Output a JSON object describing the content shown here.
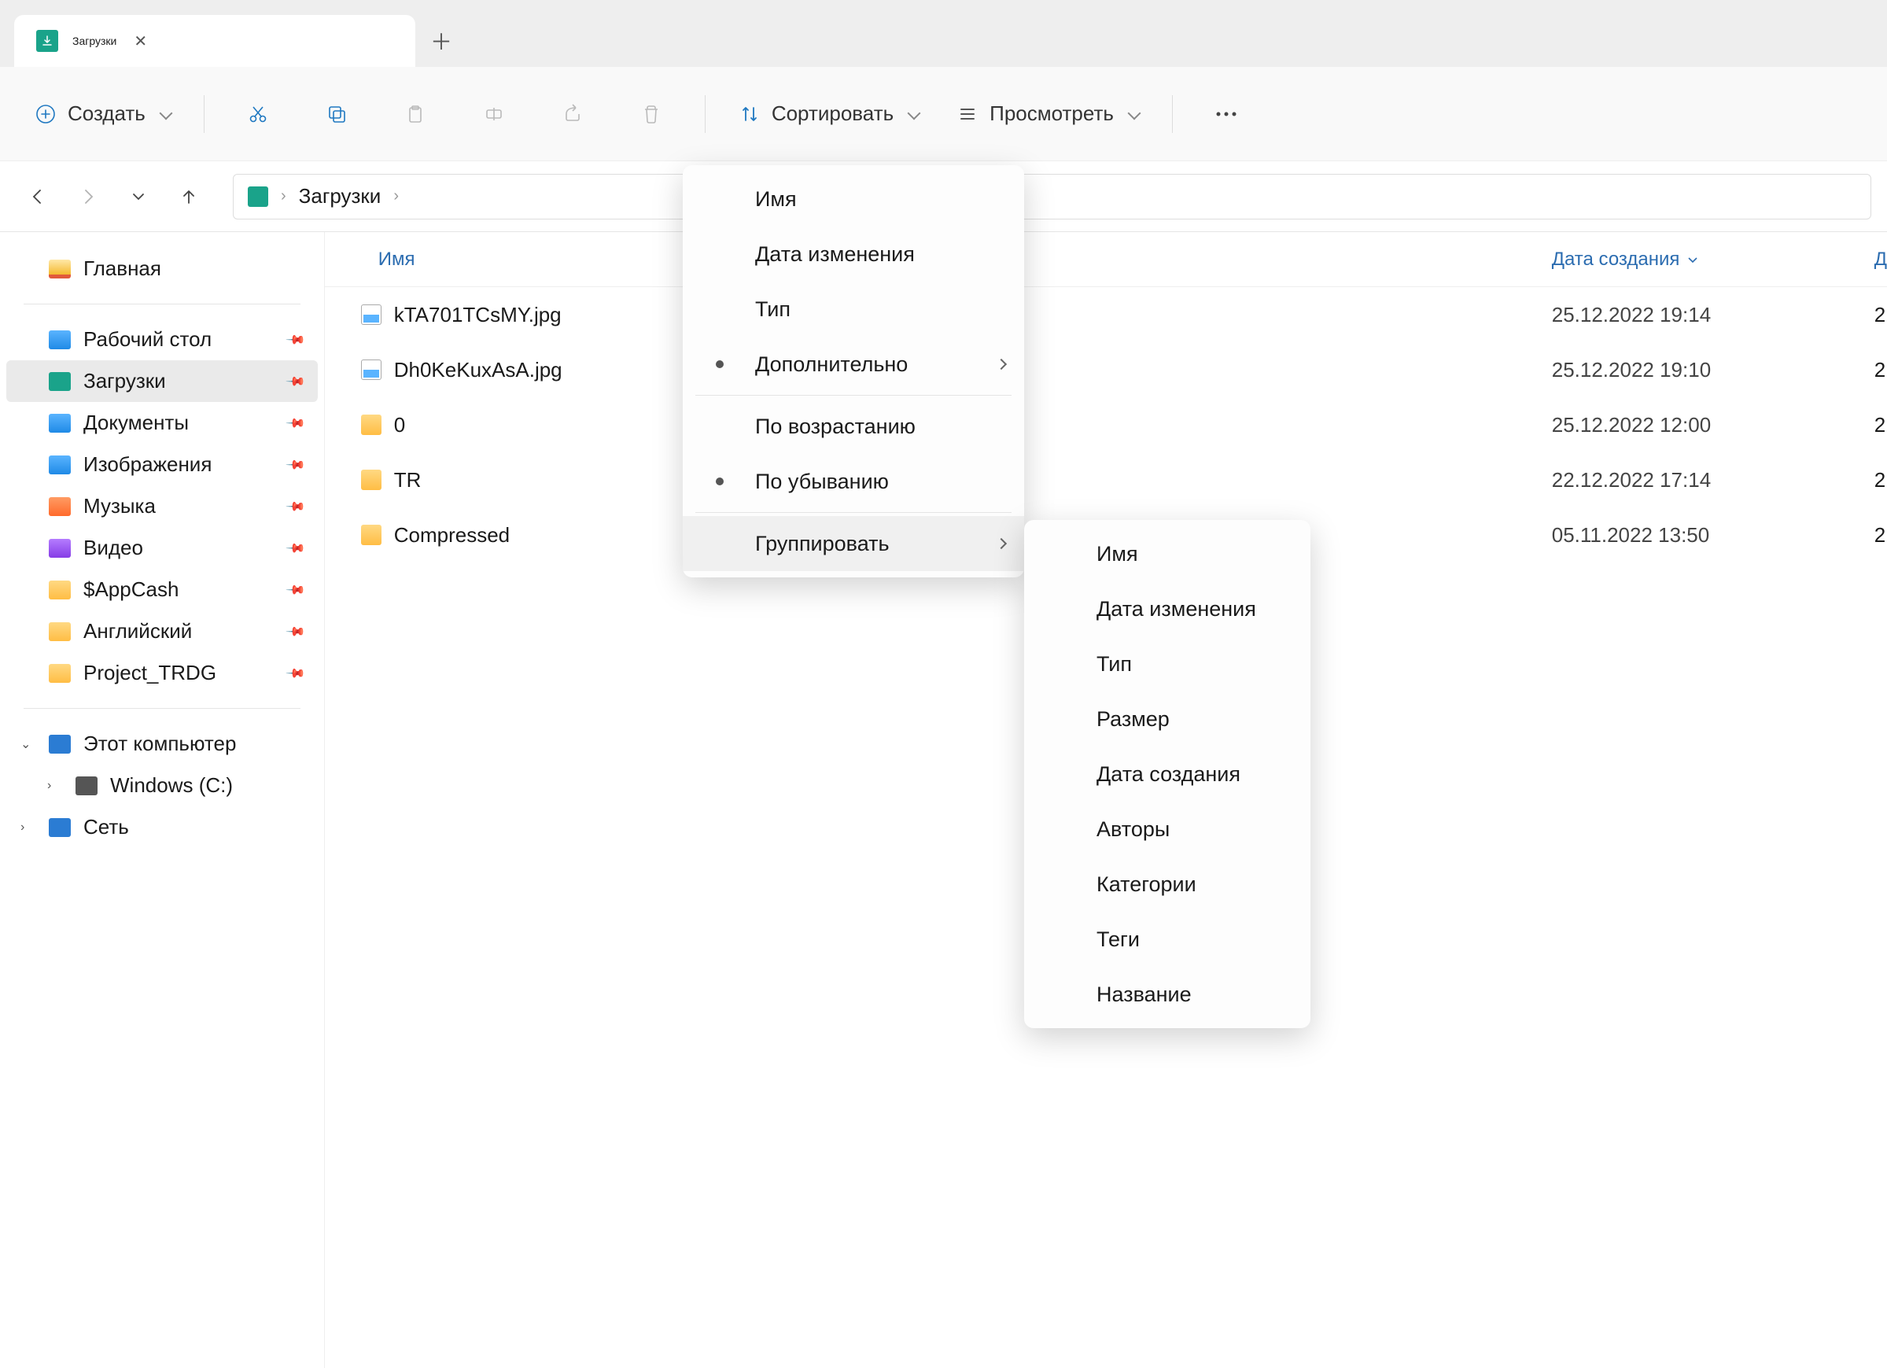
{
  "tab": {
    "title": "Загрузки"
  },
  "toolbar": {
    "create": "Создать",
    "sort": "Сортировать",
    "view": "Просмотреть"
  },
  "breadcrumb": {
    "location": "Загрузки"
  },
  "sidebar": {
    "home": "Главная",
    "pinned": [
      "Рабочий стол",
      "Загрузки",
      "Документы",
      "Изображения",
      "Музыка",
      "Видео",
      "$AppCash",
      "Английский",
      "Project_TRDG"
    ],
    "pc": "Этот компьютер",
    "drive": "Windows (C:)",
    "network": "Сеть"
  },
  "columns": {
    "name": "Имя",
    "created": "Дата создания",
    "extra": "Д"
  },
  "files": [
    {
      "name": "kTA701TCsMY.jpg",
      "type": "image",
      "created": "25.12.2022 19:14",
      "extra": "2"
    },
    {
      "name": "Dh0KeKuxAsA.jpg",
      "type": "image",
      "created": "25.12.2022 19:10",
      "extra": "2"
    },
    {
      "name": "0",
      "type": "folder",
      "created": "25.12.2022 12:00",
      "extra": "2"
    },
    {
      "name": "TR",
      "type": "folder",
      "created": "22.12.2022 17:14",
      "extra": "2"
    },
    {
      "name": "Compressed",
      "type": "folder",
      "created": "05.11.2022 13:50",
      "extra": "2"
    }
  ],
  "sort_menu": {
    "name": "Имя",
    "date_mod": "Дата изменения",
    "type": "Тип",
    "more": "Дополнительно",
    "asc": "По возрастанию",
    "desc": "По убыванию",
    "group": "Группировать"
  },
  "group_menu": [
    "Имя",
    "Дата изменения",
    "Тип",
    "Размер",
    "Дата создания",
    "Авторы",
    "Категории",
    "Теги",
    "Название"
  ]
}
